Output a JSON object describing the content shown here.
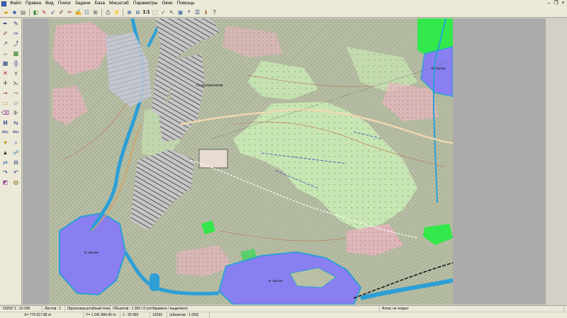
{
  "menu": {
    "items": [
      "Файл",
      "Правка",
      "Вид",
      "Поиск",
      "Задачи",
      "База",
      "Масштаб",
      "Параметры",
      "Окно",
      "Помощь"
    ]
  },
  "toolbar": {
    "zoom_one_to_one": "1:1",
    "icons": [
      "open-icon",
      "save-icon",
      "print-icon",
      "layers-icon",
      "select-icon",
      "pointer-icon",
      "measure-icon",
      "text-tool-icon",
      "table-icon",
      "lightning-icon",
      "zoom-in-icon",
      "zoom-out-icon",
      "cursor-icon",
      "select-area-icon",
      "text-search-icon",
      "properties-icon",
      "help-icon"
    ]
  },
  "tools": {
    "labels": {
      "h": "H",
      "abc1": "Abc",
      "abc2": "Abc"
    }
  },
  "map": {
    "labels": {
      "settlement": "Староянкогиляв",
      "lake_west": "В. Иалом",
      "lake_south": "В. Иалом",
      "lake_northeast": "В. Иалом"
    },
    "colors": {
      "background": "#b8bfa4",
      "hatch": "#9aa392",
      "water": "#8a7ff0",
      "river": "#2d9fd6",
      "meadow": "#c9e8b4",
      "bright_green": "#33e84a",
      "pink": "#e8b6c0",
      "buildings": "#bcbcbc"
    }
  },
  "status": {
    "sheet": "'10293' 1 : 10 000",
    "sheets": "Листов : 1",
    "plan": "(Крупномасштабный план)",
    "objects": "Объектов : 1 093 / 0 (отображено / выделено)",
    "atlas": "Атлас не открыт",
    "x": "X= 776 617.86 m",
    "y": "Y= 1 241 884.45 m",
    "scale": "1 : 25 000",
    "map_name": "10293",
    "object_count": "(объектов : 1 093)"
  }
}
